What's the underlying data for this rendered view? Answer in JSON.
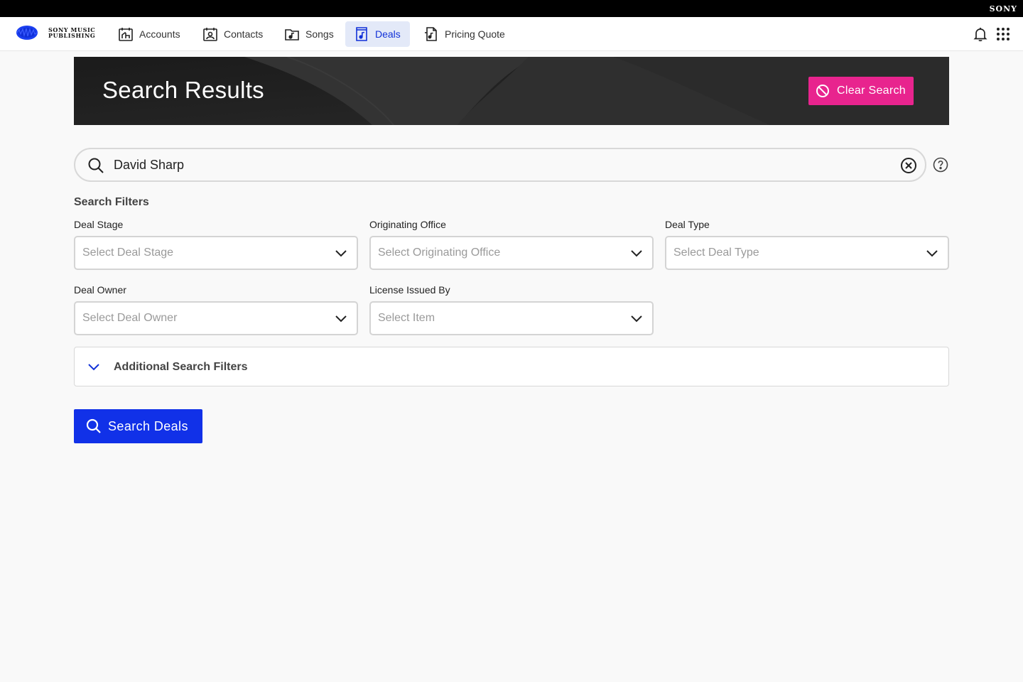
{
  "topbar": {
    "brand": "SONY"
  },
  "nav": {
    "brand_line1": "SONY MUSIC",
    "brand_line2": "PUBLISHING",
    "items": [
      {
        "label": "Accounts",
        "icon": "calendar-building-icon",
        "active": false
      },
      {
        "label": "Contacts",
        "icon": "contact-card-icon",
        "active": false
      },
      {
        "label": "Songs",
        "icon": "music-folder-icon",
        "active": false
      },
      {
        "label": "Deals",
        "icon": "music-document-icon",
        "active": true
      },
      {
        "label": "Pricing Quote",
        "icon": "pricing-document-icon",
        "active": false
      }
    ],
    "right_icons": [
      "bell-icon",
      "app-grid-icon"
    ]
  },
  "hero": {
    "title": "Search Results",
    "clear_button": "Clear Search"
  },
  "search": {
    "value": "David Sharp"
  },
  "filters": {
    "heading": "Search Filters",
    "fields": [
      {
        "label": "Deal Stage",
        "placeholder": "Select Deal Stage"
      },
      {
        "label": "Originating Office",
        "placeholder": "Select Originating Office"
      },
      {
        "label": "Deal Type",
        "placeholder": "Select Deal Type"
      },
      {
        "label": "Deal Owner",
        "placeholder": "Select Deal Owner"
      },
      {
        "label": "License Issued By",
        "placeholder": "Select Item"
      }
    ],
    "additional": "Additional Search Filters"
  },
  "actions": {
    "search_button": "Search Deals"
  },
  "colors": {
    "accent_blue": "#1131e8",
    "clear_pink": "#e8248e",
    "active_nav_bg": "#e3e9f8"
  }
}
